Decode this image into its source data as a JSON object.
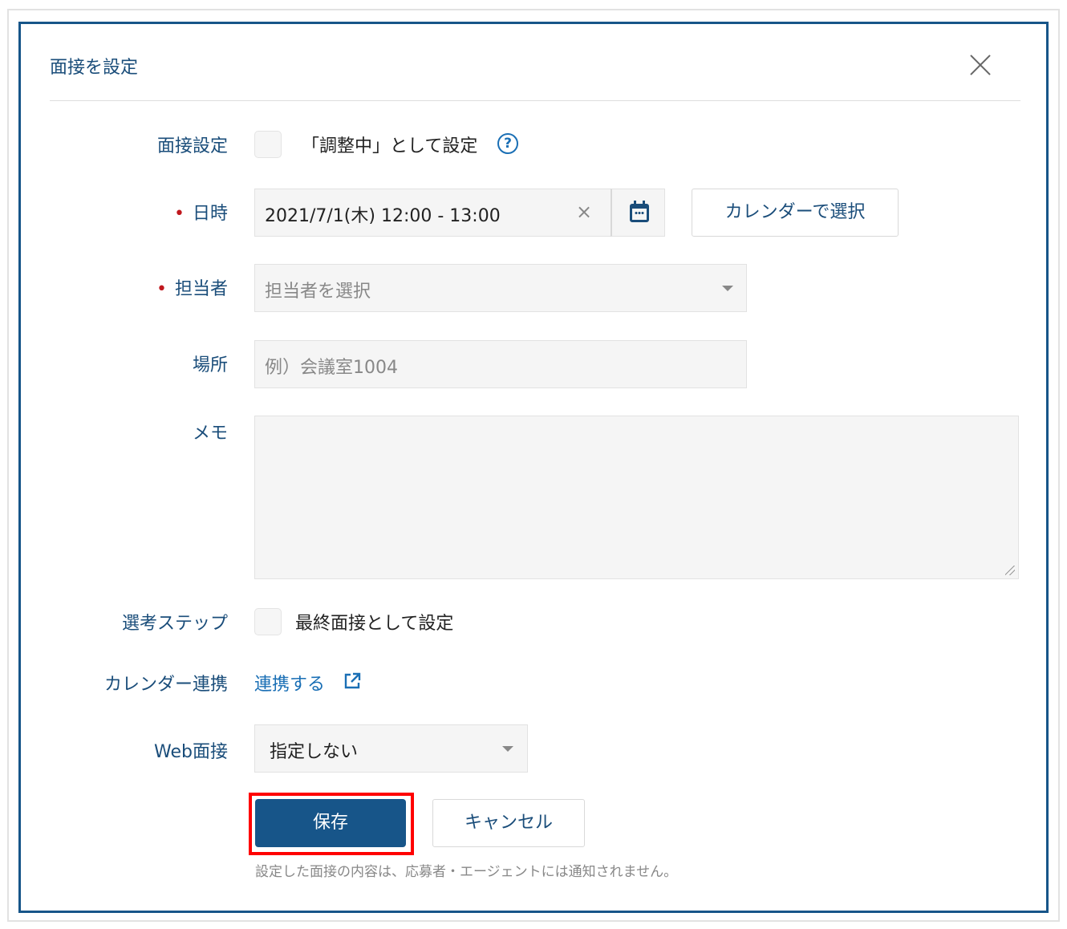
{
  "modal": {
    "title": "面接を設定",
    "close_label": "×"
  },
  "form": {
    "interview_setting": {
      "label": "面接設定",
      "checkbox_label": "「調整中」として設定",
      "checked": false,
      "help_glyph": "?"
    },
    "datetime": {
      "required_mark": "•",
      "label": "日時",
      "value": "2021/7/1(木) 12:00 - 13:00",
      "clear_glyph": "×",
      "calendar_button": "カレンダーで選択"
    },
    "assignee": {
      "required_mark": "•",
      "label": "担当者",
      "placeholder": "担当者を選択"
    },
    "location": {
      "label": "場所",
      "placeholder": "例）会議室1004"
    },
    "memo": {
      "label": "メモ",
      "value": ""
    },
    "selection_step": {
      "label": "選考ステップ",
      "checkbox_label": "最終面接として設定",
      "checked": false
    },
    "calendar_link": {
      "label": "カレンダー連携",
      "link_text": "連携する"
    },
    "web_interview": {
      "label": "Web面接",
      "selected": "指定しない"
    }
  },
  "actions": {
    "save": "保存",
    "cancel": "キャンセル",
    "note": "設定した面接の内容は、応募者・エージェントには通知されません。"
  },
  "colors": {
    "primary": "#175589",
    "label": "#1a4d7a",
    "link": "#1a6fb5",
    "required": "#c0181e",
    "highlight": "#ff0000"
  }
}
